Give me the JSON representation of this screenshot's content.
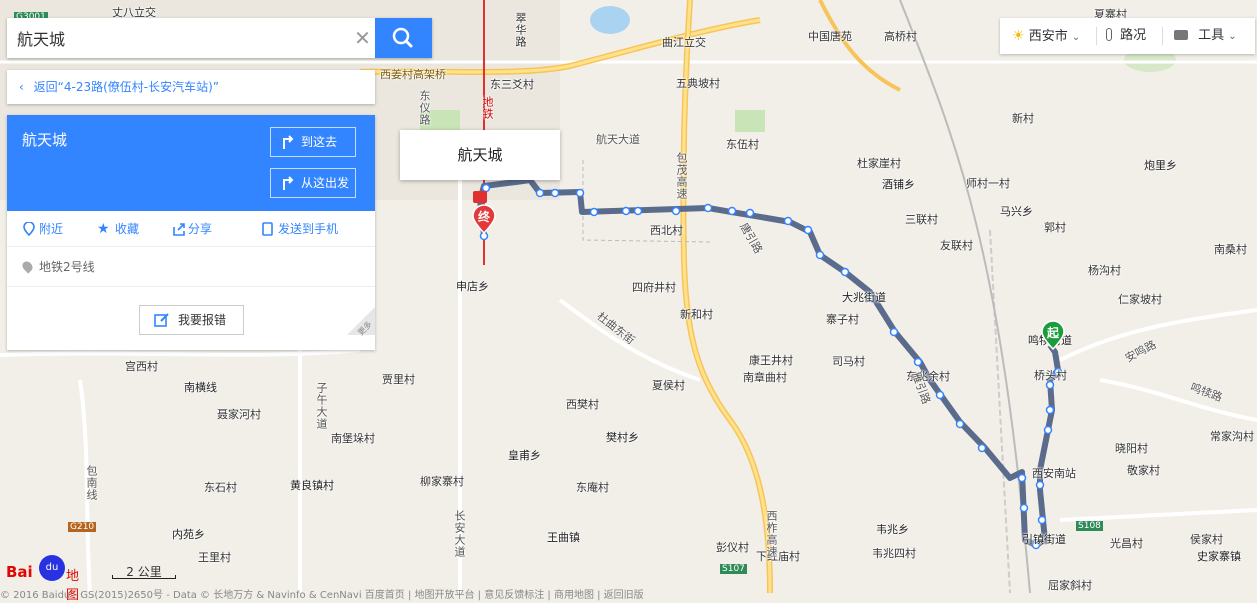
{
  "search": {
    "value": "航天城",
    "placeholder": ""
  },
  "back": {
    "label": "返回“4-23路(僚伍村-长安汽车站)”"
  },
  "place": {
    "title": "航天城",
    "go_here": "到这去",
    "from_here": "从这出发",
    "actions": [
      "附近",
      "收藏",
      "分享",
      "发送到手机"
    ],
    "more": "更多",
    "address": "地铁2号线",
    "report": "我要报错"
  },
  "popup": {
    "title": "航天城"
  },
  "toolbar": {
    "city": "西安市",
    "traffic": "路况",
    "tools": "工具"
  },
  "markers": {
    "start": "起",
    "end": "终"
  },
  "scale": "2 公里",
  "logo": {
    "text": "Bai",
    "du": "du",
    "map": "地图"
  },
  "copyright": "© 2016 Baidu - GS(2015)2650号 - Data © 长地万方 & Navinfo & CenNavi  百度首页 | 地图开放平台 | 意见反馈标注 | 商用地图 | 返回旧版",
  "map_labels": [
    "丈八立交",
    "西姜村高架桥",
    "翠华路",
    "曲江立交",
    "中国唐苑",
    "高桥村",
    "夏寨村",
    "东三爻村",
    "五典坡村",
    "航天大道",
    "东伍村",
    "杜家崖村",
    "酒铺乡",
    "师村一村",
    "炮里乡",
    "新村",
    "西北村",
    "三联村",
    "马兴乡",
    "郭村",
    "友联村",
    "南桑村",
    "杨沟村",
    "仁家坡村",
    "申店乡",
    "四府井村",
    "新和村",
    "大兆街道",
    "寨子村",
    "鸣犊街道",
    "桥头村",
    "杜曲东街",
    "康王井村",
    "南章曲村",
    "司马村",
    "东兆余村",
    "安鸣路",
    "鸣犊路",
    "南横线",
    "宫西村",
    "聂家河村",
    "贾里村",
    "夏侯村",
    "西樊村",
    "樊村乡",
    "南堡垛村",
    "皇甫乡",
    "晓阳村",
    "常家沟村",
    "东石村",
    "黄良镇村",
    "柳家寨村",
    "东庵村",
    "西安南站",
    "敬家村",
    "内苑乡",
    "王里村",
    "王曲镇",
    "彭仪村",
    "韦兆乡",
    "韦兆四村",
    "下红庙村",
    "引镇街道",
    "光昌村",
    "侯家村",
    "史家寨镇",
    "屈家斜村",
    "包茂高速",
    "西柞高速",
    "长安大道",
    "子午大道",
    "地铁2号线",
    "东仪路",
    "包南线",
    "唐引路",
    "雁引路",
    "G210",
    "S107",
    "S108",
    "G3001",
    "地铁"
  ]
}
